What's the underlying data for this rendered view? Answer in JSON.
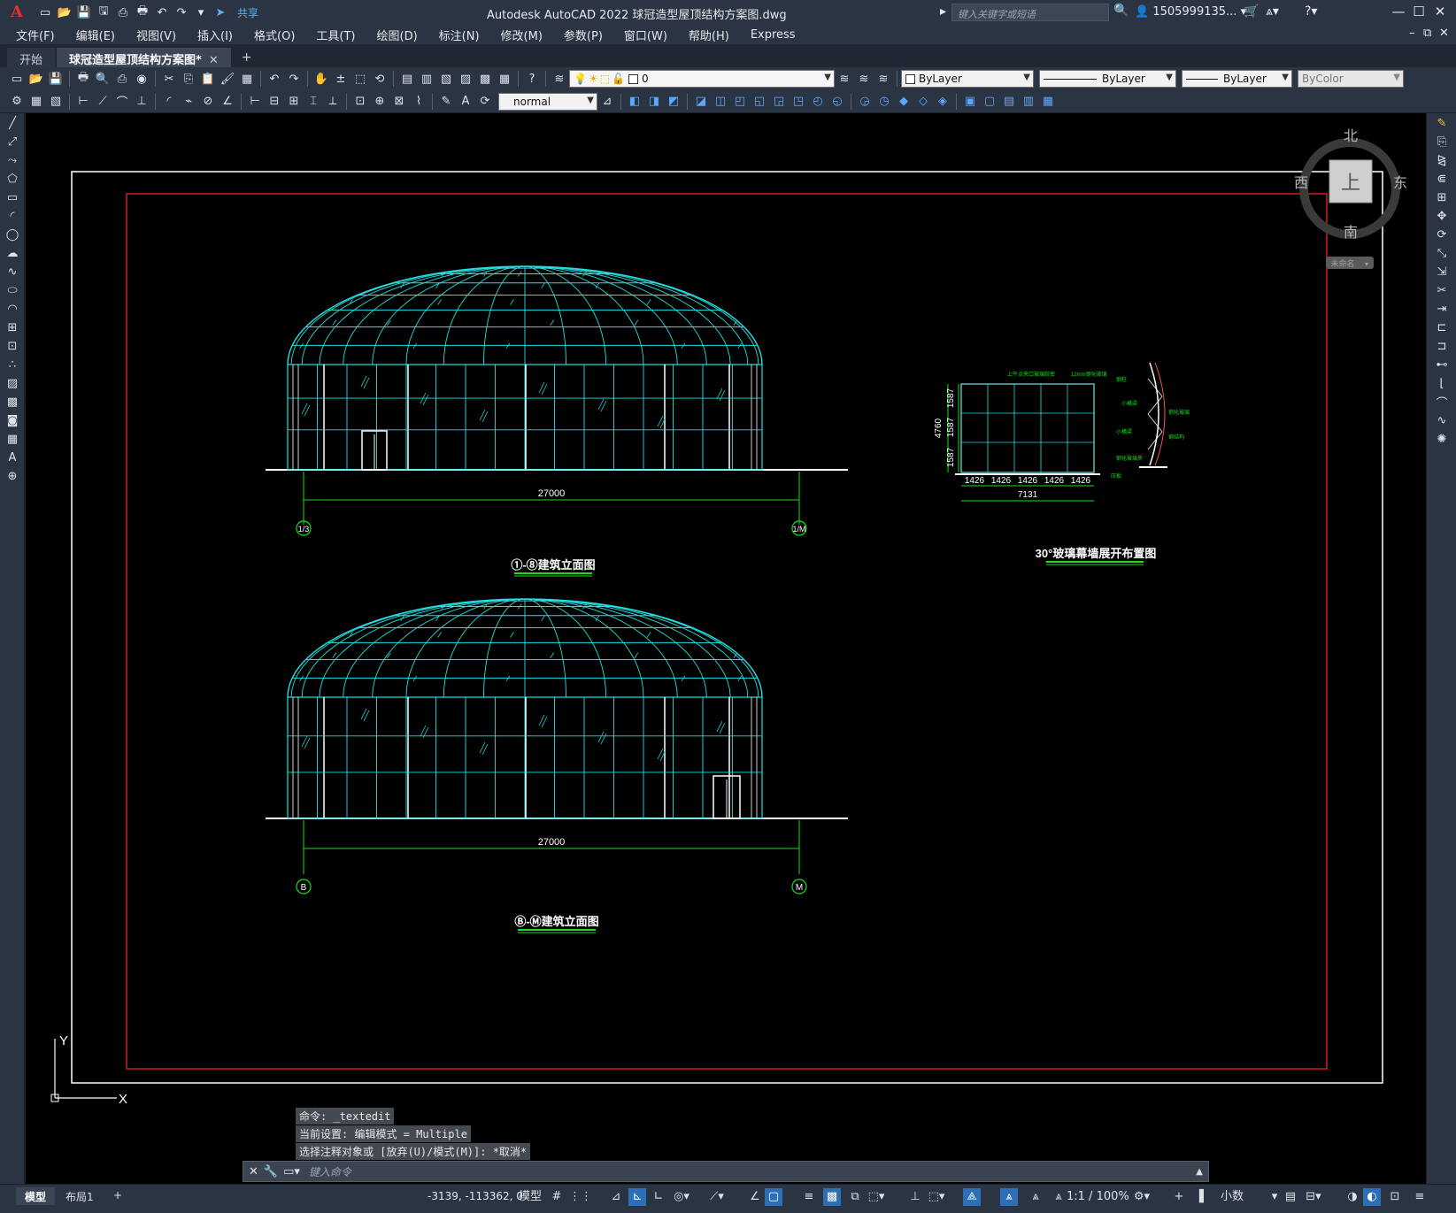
{
  "app": {
    "logo": "A",
    "title": "Autodesk AutoCAD 2022   球冠造型屋顶结构方案图.dwg",
    "search_placeholder": "键入关键字或短语",
    "user": "1505999135...",
    "share": "共享"
  },
  "menu": [
    "文件(F)",
    "编辑(E)",
    "视图(V)",
    "插入(I)",
    "格式(O)",
    "工具(T)",
    "绘图(D)",
    "标注(N)",
    "修改(M)",
    "参数(P)",
    "窗口(W)",
    "帮助(H)",
    "Express"
  ],
  "tabs": [
    {
      "label": "开始"
    },
    {
      "label": "球冠造型屋顶结构方案图*"
    }
  ],
  "toolbar": {
    "layer_value": "0",
    "color_value": "ByLayer",
    "linetype_value": "ByLayer",
    "lineweight_value": "ByLayer",
    "plotstyle_value": "ByColor",
    "textstyle_value": "normal"
  },
  "viewcube": {
    "north": "北",
    "south": "南",
    "east": "东",
    "west": "西",
    "top": "上",
    "wcs": "未命名"
  },
  "drawing": {
    "elev1": {
      "dim": "27000",
      "left_axis": "1/3",
      "right_axis": "1/M",
      "title": "①-⑧建筑立面图"
    },
    "elev2": {
      "dim": "27000",
      "left_axis": "B",
      "right_axis": "M",
      "title": "Ⓑ-Ⓜ建筑立面图"
    },
    "detail": {
      "title": "30°玻璃幕墙展开布置图",
      "height_total": "4760",
      "height_parts": [
        "1587",
        "1587",
        "1587"
      ],
      "width_parts": [
        "1426",
        "1426",
        "1426",
        "1426",
        "1426"
      ],
      "width_total": "7131",
      "notes": [
        "上午点夹口玻璃胶密",
        "12mm钢化玻璃",
        "钢柱",
        "小横梁",
        "小横梁",
        "钢化玻璃夹",
        "钢化玻璃",
        "钢结构",
        "压板"
      ]
    },
    "ucs_x": "X",
    "ucs_y": "Y"
  },
  "command": {
    "history": [
      "命令: _textedit",
      "当前设置: 编辑模式 = Multiple",
      "选择注释对象或 [放弃(U)/模式(M)]: *取消*"
    ],
    "placeholder": "键入命令"
  },
  "status": {
    "layout_tabs": [
      "模型",
      "布局1"
    ],
    "coords": "-3139, -113362, 0",
    "model_label": "模型",
    "scale": "1:1 / 100%",
    "units": "小数"
  }
}
